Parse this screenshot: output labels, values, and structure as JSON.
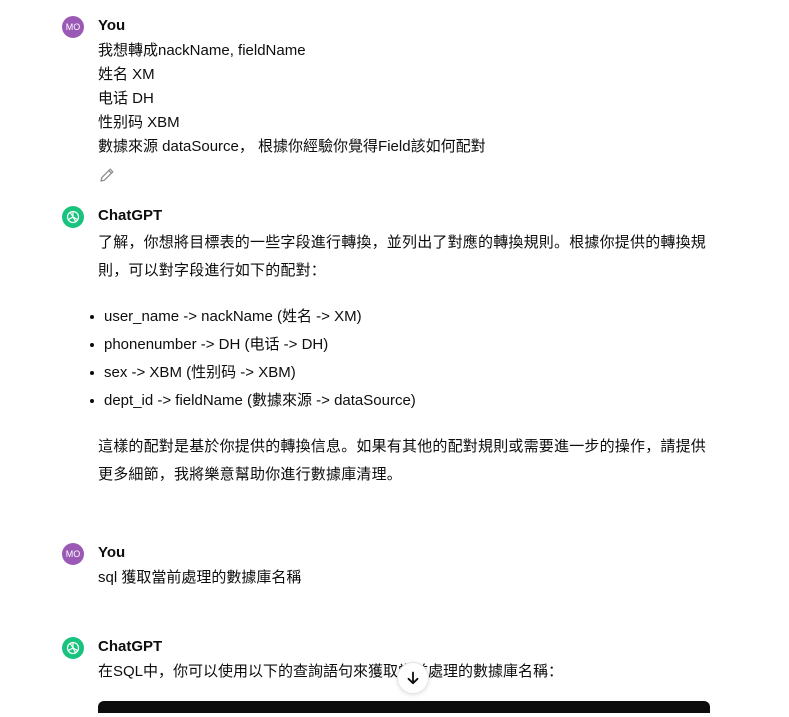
{
  "messages": [
    {
      "author": "You",
      "avatar_initials": "MO",
      "lines": [
        "我想轉成nackName, fieldName",
        "姓名  XM",
        "电话  DH",
        "性别码 XBM",
        "數據來源 dataSource，  根據你經驗你覺得Field該如何配對"
      ]
    },
    {
      "author": "ChatGPT",
      "intro": "了解，你想將目標表的一些字段進行轉換，並列出了對應的轉換規則。根據你提供的轉換規則，可以對字段進行如下的配對：",
      "items": [
        "user_name -> nackName (姓名 -> XM)",
        "phonenumber -> DH (电话 -> DH)",
        "sex -> XBM (性别码 -> XBM)",
        "dept_id -> fieldName (數據來源 -> dataSource)"
      ],
      "outro": "這樣的配對是基於你提供的轉換信息。如果有其他的配對規則或需要進一步的操作，請提供更多細節，我將樂意幫助你進行數據庫清理。"
    },
    {
      "author": "You",
      "avatar_initials": "MO",
      "lines": [
        "sql 獲取當前處理的數據庫名稱"
      ]
    },
    {
      "author": "ChatGPT",
      "intro": "在SQL中，你可以使用以下的查詢語句來獲取當前處理的數據庫名稱："
    }
  ],
  "colors": {
    "user_avatar": "#9b59b6",
    "gpt_avatar": "#19c37d",
    "code_block": "#0d0d0d"
  },
  "icons": [
    "edit-pencil-icon",
    "openai-logo-icon",
    "arrow-down-icon"
  ]
}
